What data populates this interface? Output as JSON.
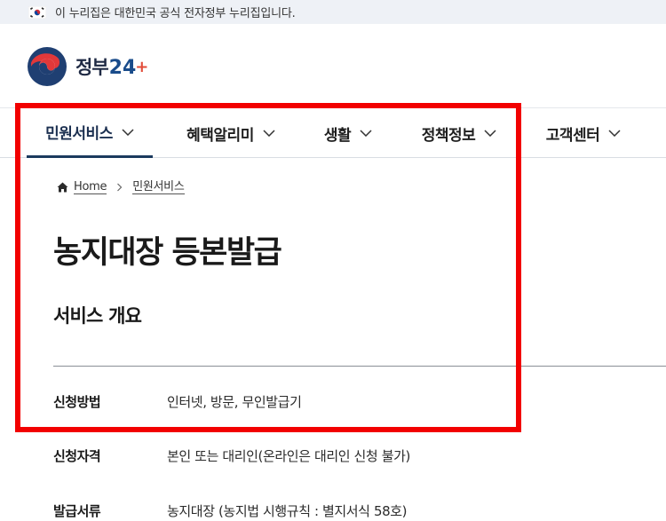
{
  "gov_banner": {
    "text": "이 누리집은 대한민국 공식 전자정부 누리집입니다.",
    "flag_icon": "korea-flag-icon"
  },
  "header": {
    "logo_text": "정부",
    "logo_number": "24",
    "logo_plus": "+",
    "logo_icon": "taegeuk-emblem-icon"
  },
  "gnb": {
    "items": [
      {
        "label": "민원서비스",
        "active": true
      },
      {
        "label": "혜택알리미",
        "active": false
      },
      {
        "label": "생활",
        "active": false
      },
      {
        "label": "정책정보",
        "active": false
      },
      {
        "label": "고객센터",
        "active": false
      }
    ],
    "chevron_icon": "chevron-down-icon"
  },
  "breadcrumb": {
    "home": "Home",
    "current": "민원서비스",
    "home_icon": "home-icon",
    "separator_icon": "chevron-right-icon"
  },
  "main": {
    "title": "농지대장 등본발급",
    "section_title": "서비스 개요",
    "rows": [
      {
        "label": "신청방법",
        "value": "인터넷, 방문, 무인발급기"
      },
      {
        "label": "신청자격",
        "value": "본인 또는 대리인(온라인은 대리인 신청 불가)"
      },
      {
        "label": "발급서류",
        "value": "농지대장 (농지법 시행규칙 : 별지서식 58호)"
      }
    ]
  },
  "colors": {
    "highlight": "#f20000",
    "nav_active_underline": "#1b3a5e",
    "banner_bg": "#eef1f6",
    "logo_blue": "#1a4c8b",
    "logo_red": "#e24c3a"
  }
}
